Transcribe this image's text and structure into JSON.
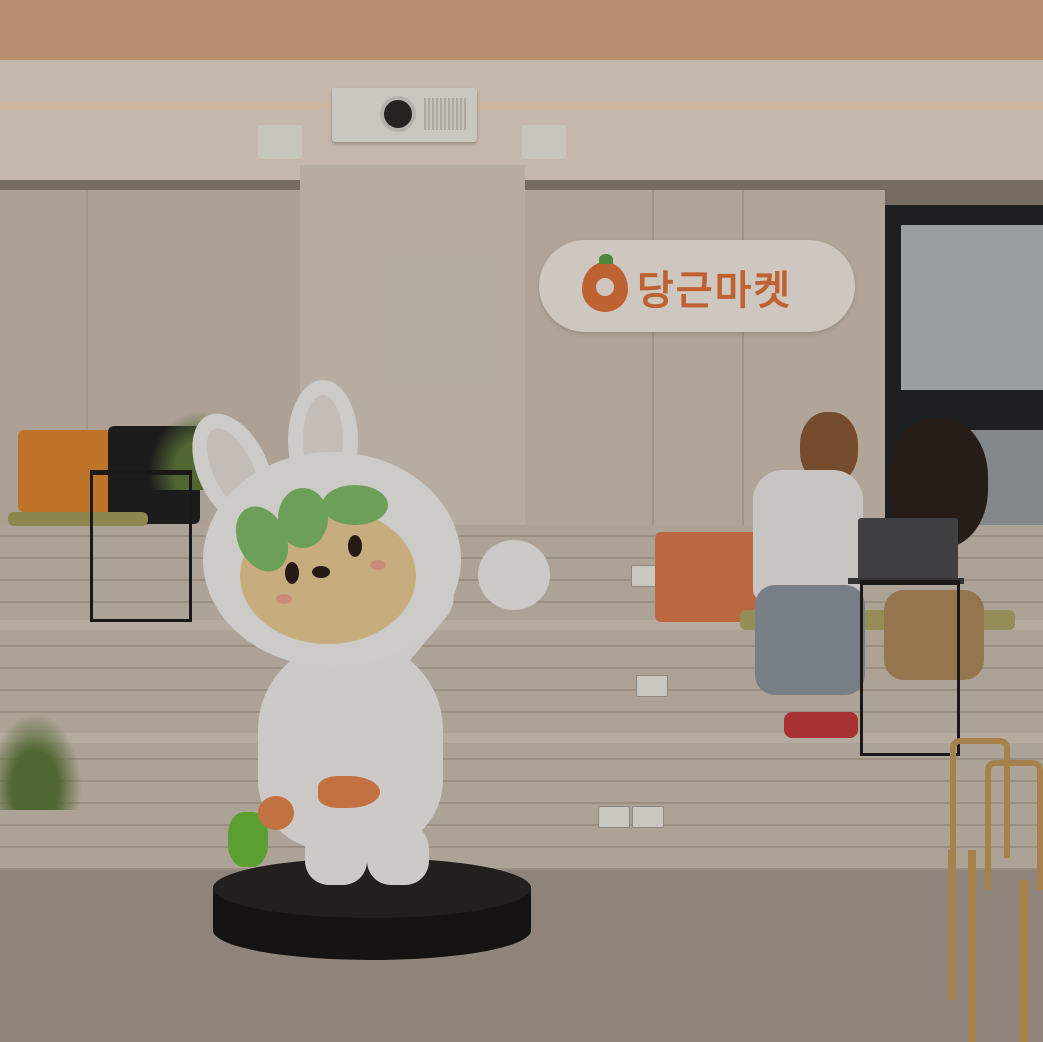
{
  "scene": {
    "description_label": "",
    "sign": {
      "text": "당근마켓",
      "brand_color": "#e4753a"
    },
    "icons": [
      "carrot-logo-icon",
      "projector-icon",
      "laptop-icon"
    ]
  }
}
